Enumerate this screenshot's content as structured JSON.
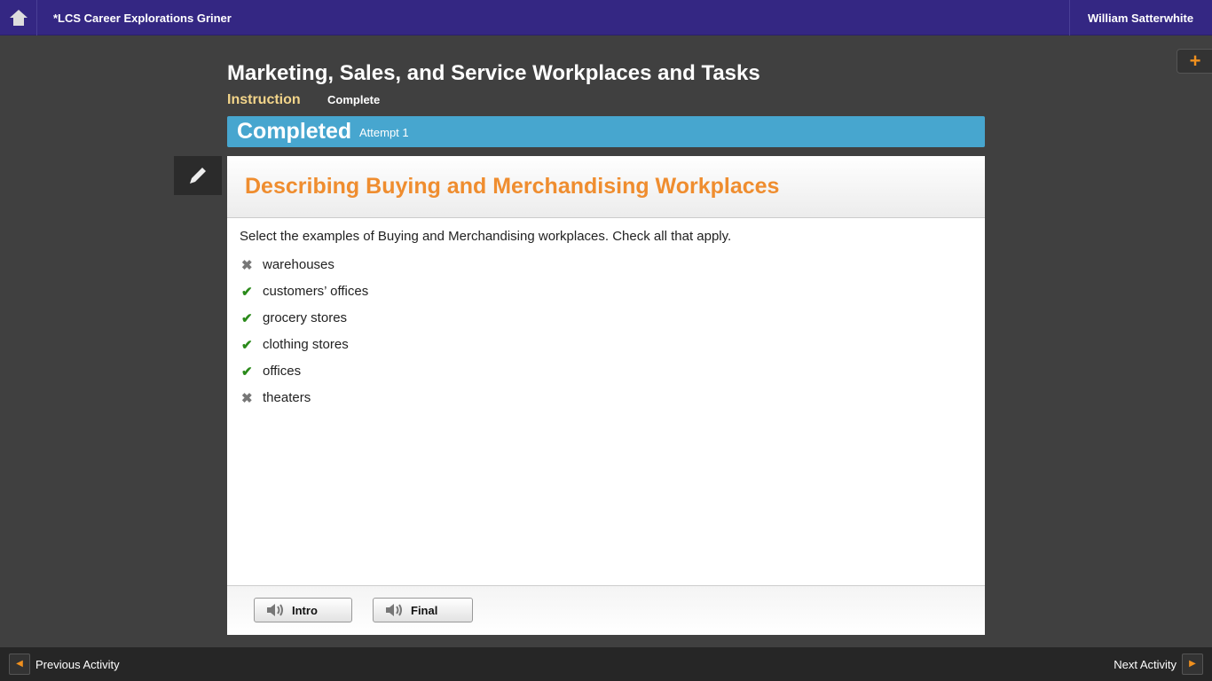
{
  "header": {
    "course": "*LCS Career Explorations Griner",
    "user": "William Satterwhite"
  },
  "page": {
    "title": "Marketing, Sales, and Service Workplaces and Tasks",
    "section": "Instruction",
    "status": "Complete"
  },
  "banner": {
    "status": "Completed",
    "attempt": "Attempt 1"
  },
  "activity": {
    "heading": "Describing Buying and Merchandising Workplaces",
    "question": "Select the examples of Buying and Merchandising workplaces. Check all that apply.",
    "options": [
      {
        "label": "warehouses",
        "correct": false
      },
      {
        "label": "customers’ offices",
        "correct": true
      },
      {
        "label": "grocery stores",
        "correct": true
      },
      {
        "label": "clothing stores",
        "correct": true
      },
      {
        "label": "offices",
        "correct": true
      },
      {
        "label": "theaters",
        "correct": false
      }
    ],
    "intro_label": "Intro",
    "final_label": "Final"
  },
  "footer": {
    "prev": "Previous Activity",
    "next": "Next Activity"
  }
}
